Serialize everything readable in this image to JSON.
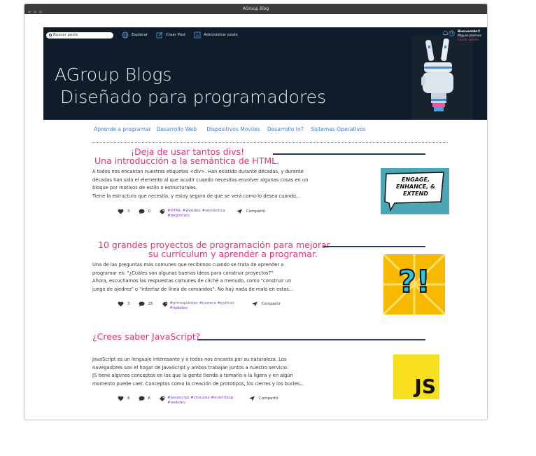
{
  "window": {
    "title": "AGroup Blog"
  },
  "topnav": {
    "search_placeholder": "Buscar posts",
    "links": [
      "Explorar",
      "Crear Post",
      "Administrar posts"
    ]
  },
  "user": {
    "greeting": "Bienvenido!!",
    "name": "Miguel Jiménez",
    "logout": "Cerrar sesión"
  },
  "hero": {
    "line1": "AGroup Blogs",
    "line2": "Diseñado para programadores"
  },
  "categories": [
    "Aprende a programar",
    "Desarrollo Web",
    "Dispositivos Moviles",
    "Desarrollo IoT",
    "Sistemas Operativos"
  ],
  "posts": [
    {
      "title_1": "¡Deja de usar tantos divs!",
      "title_2": "Una introducción a la semántica de HTML.",
      "excerpt": [
        "A todos nos encantan nuestras etiquetas <div>. Han existido durante décadas, y durante",
        "décadas han sido el elemento al que acudir cuando necesitas envolver algunas cosas en un",
        "bloque por motivos de estilo o estructurales.",
        "Tiene la estructura que necesita, y estoy seguro de que se verá como lo desea cuando..."
      ],
      "likes": "3",
      "comments": "0",
      "tags": "#HTML #webdev #semántica #beginners",
      "share": "Compartir",
      "thumb_text": [
        "ENGAGE,",
        "ENHANCE, &",
        "EXTEND"
      ]
    },
    {
      "title_1": "10 grandes proyectos de programación para mejorar",
      "title_2": "su currículum y aprender a programar.",
      "excerpt": [
        "Una de las preguntas más comunes que recibimos cuando se trata de aprender a",
        "programar es: \"¿Cuáles son algunas buenas ideas para construir proyectos?\"",
        "Ahora, escuchamos las respuestas comunes de cliché a menudo, como \"construir un",
        "juego de ajedrez\" o \"interfaz de línea de comandos\". No hay nada de malo en estas..."
      ],
      "likes": "3",
      "comments": "25",
      "tags": "#principiantes #carrera #python #webdev",
      "share": "Compartir",
      "thumb_text": "?!"
    },
    {
      "title_1": "¿Crees saber JavaScript?",
      "excerpt": [
        "JavaScript es un lenguaje interesante y a todos nos encanta por su naturaleza. Los",
        "navegadores son el hogar de JavaScript y ambos trabajan juntos a nuestro servicio.",
        "JS tiene algunos conceptos en los que la gente tiende a tomarlo a la ligera y en algún",
        "momento puede caer. Conceptos como la creación de prototipos, los cierres y los bucles..."
      ],
      "likes": "6",
      "comments": "6",
      "tags": "#javascript #closures #eventloop #webdev",
      "share": "Compartir",
      "thumb_text": "JS"
    }
  ],
  "colors": {
    "accent_pink": "#e0337a",
    "link_blue": "#3d7fd0",
    "tag_purple": "#7a45c8",
    "hero_bg": "#0f1c29",
    "rule": "#27366b"
  }
}
